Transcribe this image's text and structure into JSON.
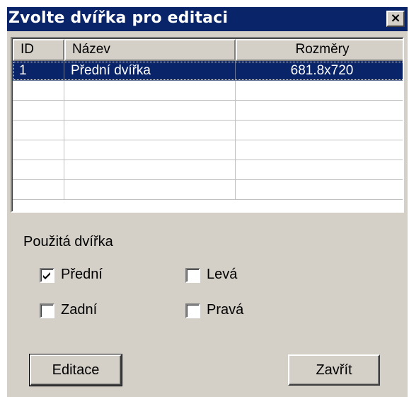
{
  "window": {
    "title": "Zvolte dvířka pro editaci",
    "close_glyph": "×"
  },
  "list": {
    "columns": [
      "ID",
      "Název",
      "Rozměry"
    ],
    "rows": [
      {
        "id": "1",
        "name": "Přední dvířka",
        "size": "681.8x720",
        "selected": true
      }
    ],
    "empty_rows": 6
  },
  "used_doors": {
    "label": "Použitá dvířka",
    "front": {
      "label": "Přední",
      "checked": true
    },
    "back": {
      "label": "Zadní",
      "checked": false
    },
    "left": {
      "label": "Levá",
      "checked": false
    },
    "right": {
      "label": "Pravá",
      "checked": false
    }
  },
  "buttons": {
    "edit": "Editace",
    "close": "Zavřít"
  },
  "colors": {
    "titlebar": "#0a246a",
    "face": "#d4d0c8",
    "selection": "#0a246a"
  }
}
